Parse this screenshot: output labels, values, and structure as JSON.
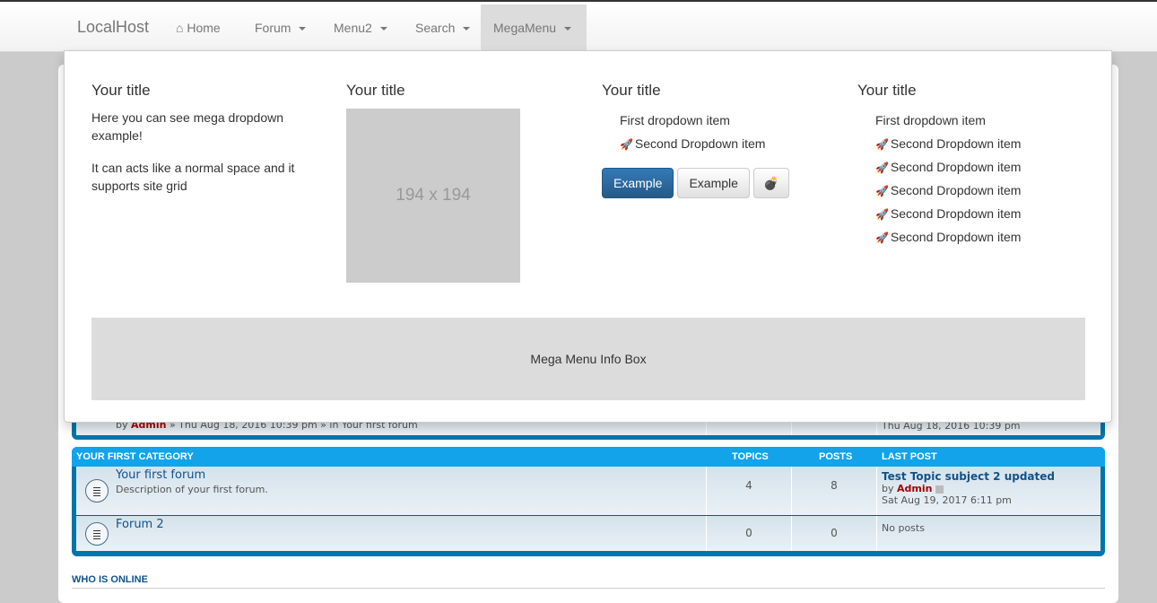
{
  "navbar": {
    "brand": "LocalHost",
    "items": [
      {
        "label": "Home",
        "icon": "home-icon"
      },
      {
        "label": "Forum"
      },
      {
        "label": "Menu2"
      },
      {
        "label": "Search"
      },
      {
        "label": "MegaMenu",
        "active": true
      }
    ]
  },
  "mega": {
    "col1": {
      "title": "Your title",
      "p1": "Here you can see mega dropdown example!",
      "p2": "It can acts like a normal space and it supports site grid"
    },
    "col2": {
      "title": "Your title",
      "placeholder": "194 x 194"
    },
    "col3": {
      "title": "Your title",
      "items": [
        "First dropdown item",
        "Second Dropdown item"
      ],
      "buttons": [
        "Example",
        "Example"
      ],
      "icon_button": "bomb-icon"
    },
    "col4": {
      "title": "Your title",
      "items": [
        "First dropdown item",
        "Second Dropdown item",
        "Second Dropdown item",
        "Second Dropdown item",
        "Second Dropdown item",
        "Second Dropdown item"
      ]
    },
    "infobox": "Mega Menu Info Box"
  },
  "hidden_row": {
    "by": "by",
    "author": "Admin",
    "meta": "» Thu Aug 18, 2016 10:39 pm » in Your first forum",
    "lastpost": "Thu Aug 18, 2016 10:39 pm"
  },
  "category": {
    "title": "YOUR FIRST CATEGORY",
    "cols": {
      "topics": "TOPICS",
      "posts": "POSTS",
      "lastpost": "LAST POST"
    },
    "forums": [
      {
        "name": "Your first forum",
        "desc": "Description of your first forum.",
        "topics": "4",
        "posts": "8",
        "last_title": "Test Topic subject 2 updated",
        "last_by": "by",
        "last_author": "Admin",
        "last_date": "Sat Aug 19, 2017 6:11 pm"
      },
      {
        "name": "Forum 2",
        "desc": "",
        "topics": "0",
        "posts": "0",
        "no_posts": "No posts"
      }
    ]
  },
  "who_online": "WHO IS ONLINE",
  "colors": {
    "category_header": "#12a3eb",
    "block_border": "#0076a8",
    "primary_button": "#286090",
    "author": "#aa0000"
  }
}
